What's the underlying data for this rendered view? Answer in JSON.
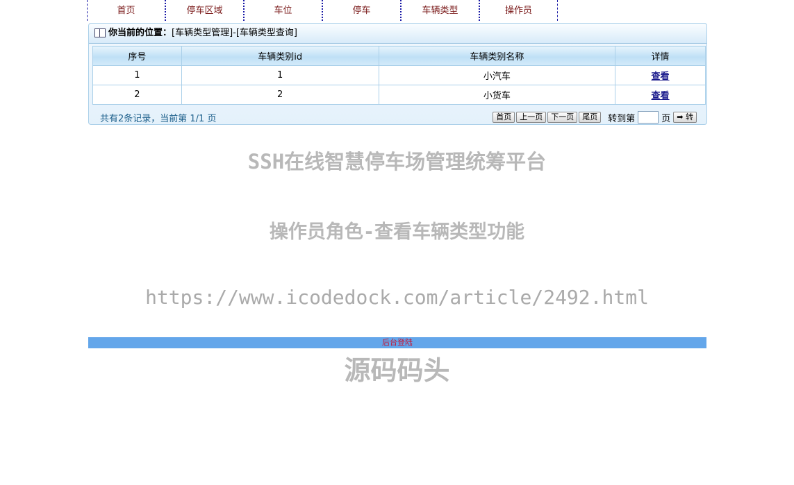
{
  "nav": {
    "items": [
      "首页",
      "停车区域",
      "车位",
      "停车",
      "车辆类型",
      "操作员"
    ]
  },
  "breadcrumb": {
    "label": "你当前的位置：",
    "path": "[车辆类型管理]-[车辆类型查询]"
  },
  "table": {
    "headers": [
      "序号",
      "车辆类别id",
      "车辆类别名称",
      "详情"
    ],
    "rows": [
      {
        "index": "1",
        "id": "1",
        "name": "小汽车",
        "detail": "查看"
      },
      {
        "index": "2",
        "id": "2",
        "name": "小货车",
        "detail": "查看"
      }
    ]
  },
  "pager": {
    "summary": "共有2条记录，当前第 1/1 页",
    "first": "首页",
    "prev": "上一页",
    "next": "下一页",
    "last": "尾页",
    "goto_label": "转到第",
    "page_word": "页",
    "go": "➡ 转"
  },
  "watermark": {
    "title": "SSH在线智慧停车场管理统筹平台",
    "subtitle": "操作员角色-查看车辆类型功能",
    "url": "https://www.icodedock.com/article/2492.html",
    "brand": "源码码头"
  },
  "login_link": "后台登陆"
}
